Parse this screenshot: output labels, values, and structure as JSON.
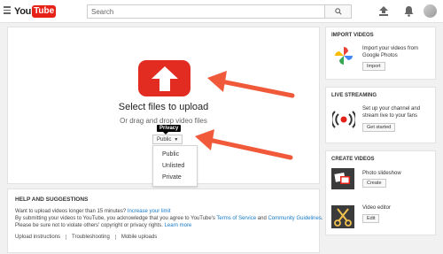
{
  "header": {
    "logo_you": "You",
    "logo_tube": "Tube",
    "search_placeholder": "Search"
  },
  "upload": {
    "select_text": "Select files to upload",
    "drag_text": "Or drag and drop video files",
    "privacy_tooltip": "Privacy",
    "privacy_selected": "Public",
    "privacy_options": [
      "Public",
      "Unlisted",
      "Private"
    ]
  },
  "help": {
    "title": "HELP AND SUGGESTIONS",
    "line1_text": "Want to upload videos longer than 15 minutes?",
    "line1_link": "Increase your limit",
    "line2_text": "By submitting your videos to YouTube, you acknowledge that you agree to YouTube's",
    "line2_link1": "Terms of Service",
    "line2_and": "and",
    "line2_link2": "Community Guidelines",
    "line2_end": ".",
    "line3_text": "Please be sure not to violate others' copyright or privacy rights.",
    "line3_link": "Learn more",
    "links": [
      "Upload instructions",
      "Troubleshooting",
      "Mobile uploads"
    ]
  },
  "import_videos": {
    "title": "IMPORT VIDEOS",
    "description": "Import your videos from Google Photos",
    "button": "Import"
  },
  "live_streaming": {
    "title": "LIVE STREAMING",
    "description": "Set up your channel and stream live to your fans",
    "button": "Get started"
  },
  "create_videos": {
    "title": "CREATE VIDEOS",
    "slideshow_label": "Photo slideshow",
    "slideshow_button": "Create",
    "editor_label": "Video editor",
    "editor_button": "Edit"
  },
  "colors": {
    "youtube_red": "#e62117",
    "upload_red": "#e22b21",
    "link_blue": "#167ac6",
    "annotation_arrow": "#f05a3a"
  }
}
